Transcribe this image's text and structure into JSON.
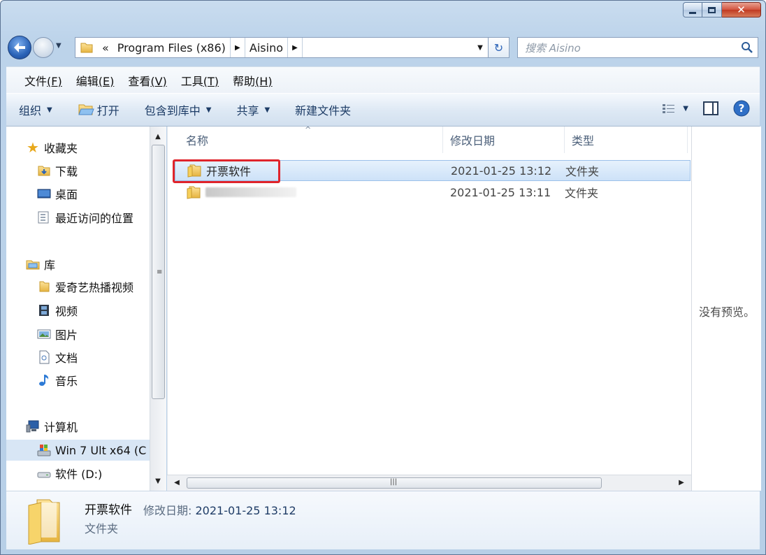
{
  "window": {
    "caption_buttons": {
      "minimize": "minimize",
      "maximize": "maximize",
      "close": "close"
    }
  },
  "address": {
    "overflow": "«",
    "segments": [
      "Program Files (x86)",
      "Aisino"
    ],
    "search_placeholder": "搜索 Aisino"
  },
  "menu": [
    {
      "label": "文件",
      "key": "(F)"
    },
    {
      "label": "编辑",
      "key": "(E)"
    },
    {
      "label": "查看",
      "key": "(V)"
    },
    {
      "label": "工具",
      "key": "(T)"
    },
    {
      "label": "帮助",
      "key": "(H)"
    }
  ],
  "commands": {
    "organize": "组织",
    "open": "打开",
    "include_library": "包含到库中",
    "share": "共享",
    "new_folder": "新建文件夹"
  },
  "nav": {
    "favorites": "收藏夹",
    "downloads": "下载",
    "desktop": "桌面",
    "recent": "最近访问的位置",
    "libraries": "库",
    "iqiyi": "爱奇艺热播视频",
    "videos": "视频",
    "pictures": "图片",
    "documents": "文档",
    "music": "音乐",
    "computer": "计算机",
    "win7": "Win 7 Ult x64 (C",
    "drive_d": "软件 (D:)"
  },
  "columns": {
    "name": "名称",
    "modified": "修改日期",
    "type": "类型"
  },
  "files": [
    {
      "name": "开票软件",
      "modified": "2021-01-25 13:12",
      "type": "文件夹",
      "selected": true,
      "highlighted": true
    },
    {
      "name": "",
      "modified": "2021-01-25 13:11",
      "type": "文件夹",
      "selected": false,
      "blurred": true
    }
  ],
  "preview": {
    "text": "没有预览。"
  },
  "details": {
    "name": "开票软件",
    "modified_label": "修改日期:",
    "modified_value": "2021-01-25 13:12",
    "type": "文件夹"
  },
  "colors": {
    "highlight_box": "#e0242b",
    "accent": "#2a63b7"
  }
}
